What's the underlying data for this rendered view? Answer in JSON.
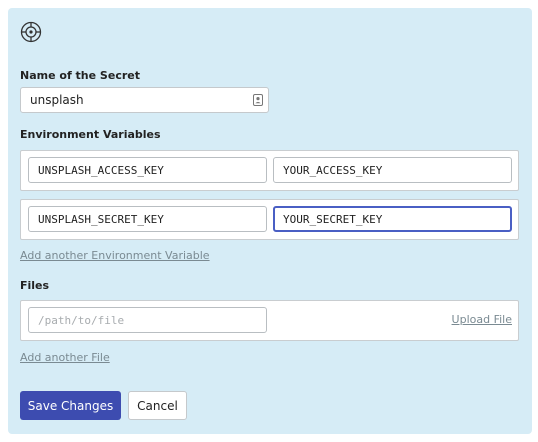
{
  "header": {
    "icon": "settings-target-icon"
  },
  "secret_name": {
    "label": "Name of the Secret",
    "value": "unsplash",
    "trailing_icon": "contact-card-icon"
  },
  "env": {
    "label": "Environment Variables",
    "rows": [
      {
        "key": "UNSPLASH_ACCESS_KEY",
        "value": "YOUR_ACCESS_KEY"
      },
      {
        "key": "UNSPLASH_SECRET_KEY",
        "value": "YOUR_SECRET_KEY"
      }
    ],
    "add_link": "Add another Environment Variable"
  },
  "files": {
    "label": "Files",
    "path_placeholder": "/path/to/file",
    "upload_link": "Upload File",
    "add_link": "Add another File"
  },
  "actions": {
    "save_label": "Save Changes",
    "cancel_label": "Cancel"
  },
  "colors": {
    "panel_bg": "#d6ecf6",
    "primary": "#3d4cb0",
    "focus_ring": "#4a5fc4",
    "link": "#7a8a92"
  }
}
